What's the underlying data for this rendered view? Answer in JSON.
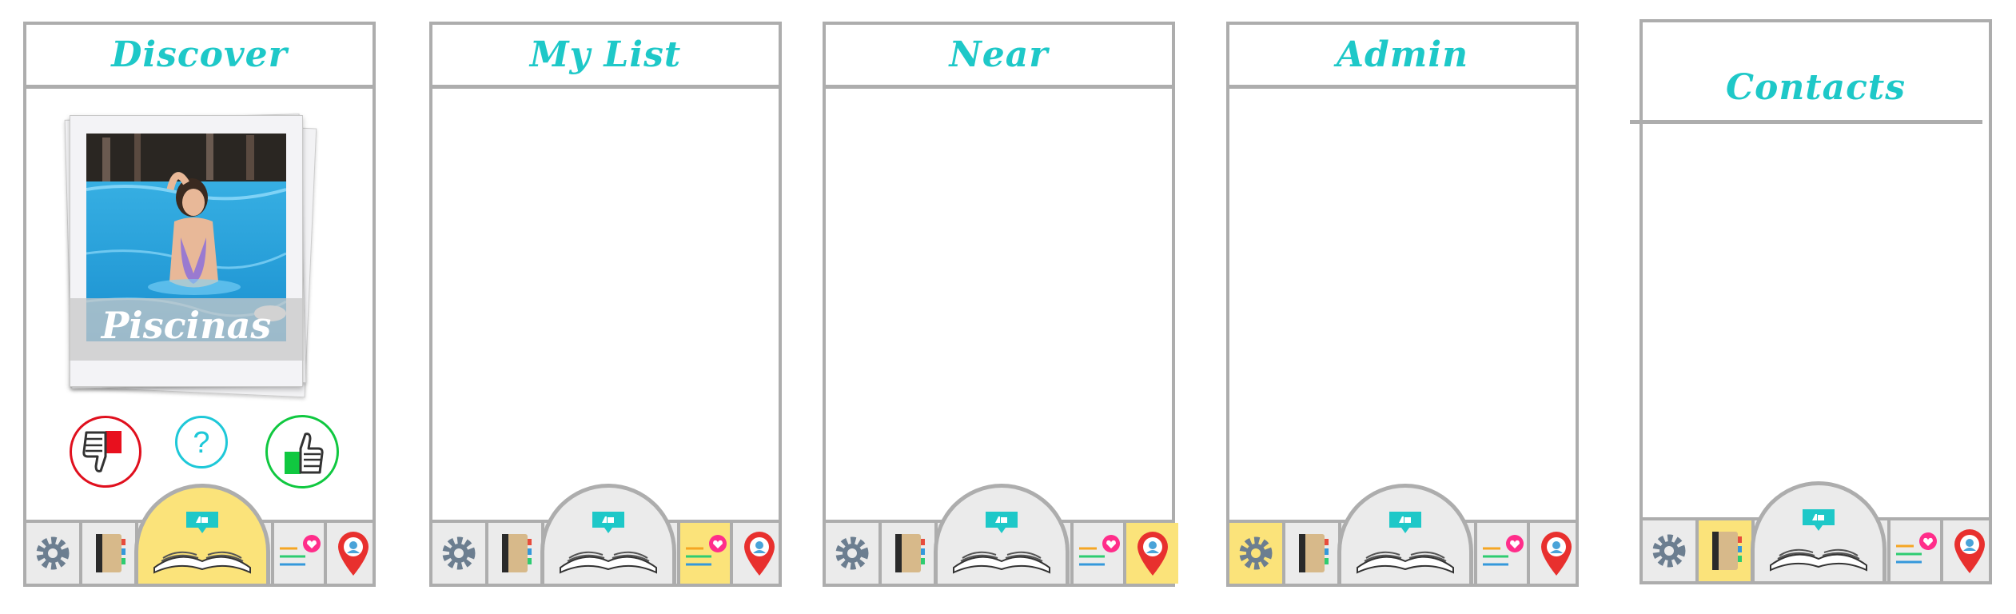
{
  "screens": [
    {
      "title": "Discover",
      "active_tab": "library"
    },
    {
      "title": "My List",
      "active_tab": "list"
    },
    {
      "title": "Near",
      "active_tab": "location"
    },
    {
      "title": "Admin",
      "active_tab": "settings"
    },
    {
      "title": "Contacts",
      "active_tab": "contacts"
    }
  ],
  "discover": {
    "card_label": "Piscinas",
    "actions": [
      {
        "name": "dislike",
        "icon": "thumbs-down-icon",
        "color": "#e0101e"
      },
      {
        "name": "unsure",
        "icon": "question-icon",
        "color": "#1ec8d8"
      },
      {
        "name": "like",
        "icon": "thumbs-up-icon",
        "color": "#10c840"
      }
    ]
  },
  "nav_icons": [
    "gear-icon",
    "address-book-icon",
    "open-book-icon",
    "heart-list-icon",
    "location-pin-icon"
  ],
  "colors": {
    "title": "#1ec8c8",
    "border": "#adadad",
    "nav_background": "#ebebeb",
    "active_tab": "#fbe37a"
  }
}
